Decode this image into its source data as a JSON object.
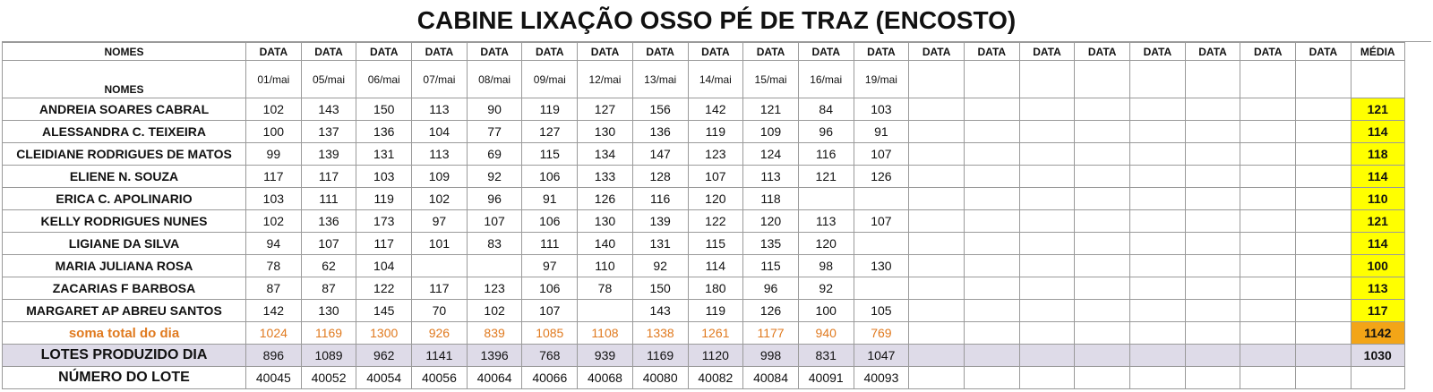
{
  "title": "CABINE LIXAÇÃO OSSO PÉ DE TRAZ (ENCOSTO)",
  "header": {
    "nomes": "NOMES",
    "data_label": "DATA",
    "media": "MÉDIA",
    "nomes_sub": "NOMES",
    "dates": [
      "01/mai",
      "05/mai",
      "06/mai",
      "07/mai",
      "08/mai",
      "09/mai",
      "12/mai",
      "13/mai",
      "14/mai",
      "15/mai",
      "16/mai",
      "19/mai",
      "",
      "",
      "",
      "",
      "",
      "",
      "",
      ""
    ]
  },
  "rows": [
    {
      "name": "ANDREIA SOARES CABRAL",
      "values": [
        "102",
        "143",
        "150",
        "113",
        "90",
        "119",
        "127",
        "156",
        "142",
        "121",
        "84",
        "103",
        "",
        "",
        "",
        "",
        "",
        "",
        "",
        ""
      ],
      "avg": "121"
    },
    {
      "name": "ALESSANDRA C. TEIXEIRA",
      "values": [
        "100",
        "137",
        "136",
        "104",
        "77",
        "127",
        "130",
        "136",
        "119",
        "109",
        "96",
        "91",
        "",
        "",
        "",
        "",
        "",
        "",
        "",
        ""
      ],
      "avg": "114"
    },
    {
      "name": "CLEIDIANE RODRIGUES DE MATOS",
      "values": [
        "99",
        "139",
        "131",
        "113",
        "69",
        "115",
        "134",
        "147",
        "123",
        "124",
        "116",
        "107",
        "",
        "",
        "",
        "",
        "",
        "",
        "",
        ""
      ],
      "avg": "118"
    },
    {
      "name": "ELIENE N. SOUZA",
      "values": [
        "117",
        "117",
        "103",
        "109",
        "92",
        "106",
        "133",
        "128",
        "107",
        "113",
        "121",
        "126",
        "",
        "",
        "",
        "",
        "",
        "",
        "",
        ""
      ],
      "avg": "114"
    },
    {
      "name": "ERICA C. APOLINARIO",
      "values": [
        "103",
        "111",
        "119",
        "102",
        "96",
        "91",
        "126",
        "116",
        "120",
        "118",
        "",
        "",
        "",
        "",
        "",
        "",
        "",
        "",
        "",
        ""
      ],
      "avg": "110"
    },
    {
      "name": "KELLY RODRIGUES NUNES",
      "values": [
        "102",
        "136",
        "173",
        "97",
        "107",
        "106",
        "130",
        "139",
        "122",
        "120",
        "113",
        "107",
        "",
        "",
        "",
        "",
        "",
        "",
        "",
        ""
      ],
      "avg": "121"
    },
    {
      "name": "LIGIANE DA SILVA",
      "values": [
        "94",
        "107",
        "117",
        "101",
        "83",
        "111",
        "140",
        "131",
        "115",
        "135",
        "120",
        "",
        "",
        "",
        "",
        "",
        "",
        "",
        "",
        ""
      ],
      "avg": "114"
    },
    {
      "name": "MARIA JULIANA ROSA",
      "values": [
        "78",
        "62",
        "104",
        "",
        "",
        "97",
        "110",
        "92",
        "114",
        "115",
        "98",
        "130",
        "",
        "",
        "",
        "",
        "",
        "",
        "",
        ""
      ],
      "avg": "100"
    },
    {
      "name": "ZACARIAS F BARBOSA",
      "values": [
        "87",
        "87",
        "122",
        "117",
        "123",
        "106",
        "78",
        "150",
        "180",
        "96",
        "92",
        "",
        "",
        "",
        "",
        "",
        "",
        "",
        "",
        ""
      ],
      "avg": "113"
    },
    {
      "name": "MARGARET AP ABREU SANTOS",
      "values": [
        "142",
        "130",
        "145",
        "70",
        "102",
        "107",
        "",
        "143",
        "119",
        "126",
        "100",
        "105",
        "",
        "",
        "",
        "",
        "",
        "",
        "",
        ""
      ],
      "avg": "117"
    }
  ],
  "soma": {
    "label": "soma total  do dia",
    "values": [
      "1024",
      "1169",
      "1300",
      "926",
      "839",
      "1085",
      "1108",
      "1338",
      "1261",
      "1177",
      "940",
      "769",
      "",
      "",
      "",
      "",
      "",
      "",
      "",
      ""
    ],
    "avg": "1142"
  },
  "lotes": {
    "label": "LOTES PRODUZIDO DIA",
    "values": [
      "896",
      "1089",
      "962",
      "1141",
      "1396",
      "768",
      "939",
      "1169",
      "1120",
      "998",
      "831",
      "1047",
      "",
      "",
      "",
      "",
      "",
      "",
      "",
      ""
    ],
    "avg": "1030"
  },
  "numero": {
    "label": "NÚMERO DO LOTE",
    "values": [
      "40045",
      "40052",
      "40054",
      "40056",
      "40064",
      "40066",
      "40068",
      "40080",
      "40082",
      "40084",
      "40091",
      "40093",
      "",
      "",
      "",
      "",
      "",
      "",
      "",
      ""
    ],
    "avg": ""
  }
}
